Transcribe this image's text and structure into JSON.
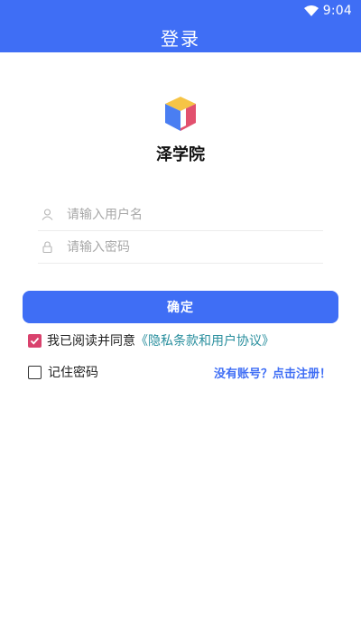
{
  "status_bar": {
    "time": "9:04",
    "icons": [
      "wifi-icon"
    ]
  },
  "header": {
    "title": "登录"
  },
  "app": {
    "logo_icon": "cube-logo-icon",
    "name": "泽学院"
  },
  "form": {
    "username": {
      "placeholder": "请输入用户名",
      "value": "",
      "icon": "user-icon"
    },
    "password": {
      "placeholder": "请输入密码",
      "value": "",
      "icon": "lock-icon"
    },
    "submit_label": "确定"
  },
  "agreement": {
    "checked": true,
    "text": "我已阅读并同意",
    "link": "《隐私条款和用户协议》"
  },
  "remember": {
    "checked": false,
    "label": "记住密码"
  },
  "register_link": "没有账号？点击注册！",
  "colors": {
    "primary": "#3f6ef5",
    "checkbox_checked": "#d9426d",
    "agreement_link": "#2a8f9e",
    "logo_yellow": "#f6c445",
    "logo_blue": "#4a7ef2",
    "logo_red": "#e2506e"
  }
}
